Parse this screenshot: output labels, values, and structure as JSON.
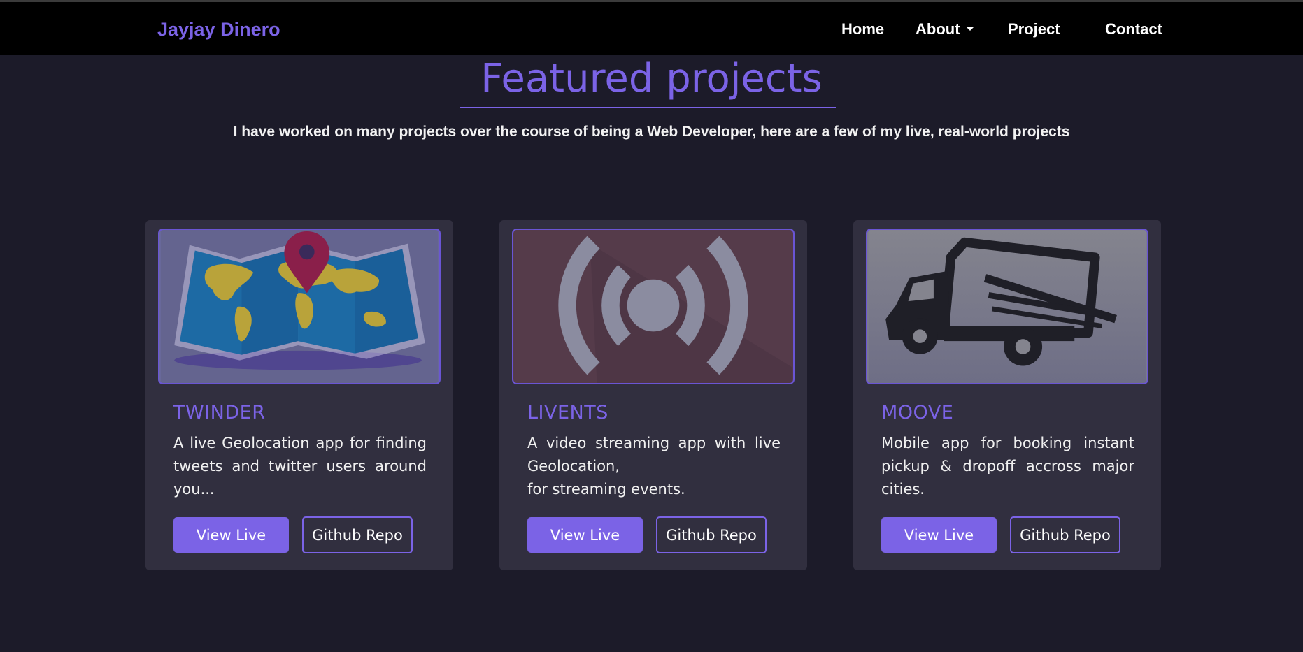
{
  "nav": {
    "brand": "Jayjay Dinero",
    "links": [
      {
        "label": "Home"
      },
      {
        "label": "About",
        "dropdown": true
      },
      {
        "label": "Project"
      },
      {
        "label": "Contact"
      }
    ]
  },
  "hero": {
    "title": "Featured projects",
    "subtitle": "I have worked on many projects over the course of being a Web Developer, here are a few of my live, real-world projects"
  },
  "projects": [
    {
      "title": "TWINDER",
      "image_icon": "world-map-pin-icon",
      "description": "A live Geolocation app for finding tweets and twitter users around you...",
      "live_label": "View Live",
      "repo_label": "Github Repo"
    },
    {
      "title": "LIVENTS",
      "image_icon": "broadcast-icon",
      "description_lines": [
        "A video streaming app with live Geolocation,",
        "for streaming events."
      ],
      "live_label": "View Live",
      "repo_label": "Github Repo"
    },
    {
      "title": "MOOVE",
      "image_icon": "delivery-truck-icon",
      "description": "Mobile app for booking instant pickup & dropoff accross major cities.",
      "live_label": "View Live",
      "repo_label": "Github Repo"
    }
  ],
  "colors": {
    "accent": "#7b63e6",
    "background": "#1c1b29",
    "card": "#312f3f",
    "navbar": "#000000"
  }
}
